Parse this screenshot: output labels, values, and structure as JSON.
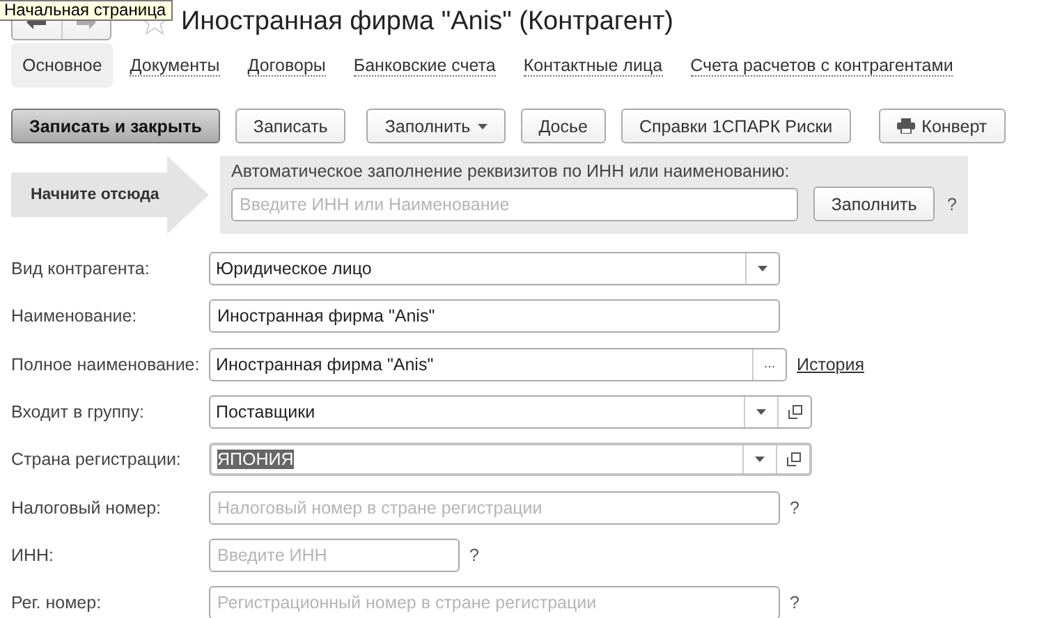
{
  "header": {
    "title": "Иностранная фирма \"Anis\" (Контрагент)",
    "tooltip": "Начальная страница"
  },
  "tabs": [
    {
      "label": "Основное",
      "selected": true
    },
    {
      "label": "Документы",
      "selected": false
    },
    {
      "label": "Договоры",
      "selected": false
    },
    {
      "label": "Банковские счета",
      "selected": false
    },
    {
      "label": "Контактные лица",
      "selected": false
    },
    {
      "label": "Счета расчетов с контрагентами",
      "selected": false
    }
  ],
  "toolbar": [
    {
      "label": "Записать и закрыть",
      "kind": "primary"
    },
    {
      "label": "Записать",
      "kind": "plain"
    },
    {
      "label": "Заполнить",
      "kind": "dropdown"
    },
    {
      "label": "Досье",
      "kind": "plain"
    },
    {
      "label": "Справки 1СПАРК Риски",
      "kind": "plain"
    },
    {
      "label": "Конверт",
      "kind": "print"
    }
  ],
  "quick_fill": {
    "hint": "Начните отсюда",
    "label": "Автоматическое заполнение реквизитов по ИНН или наименованию:",
    "placeholder": "Введите ИНН или Наименование",
    "button": "Заполнить",
    "help": "?"
  },
  "fields": [
    {
      "label": "Вид контрагента:",
      "kind": "select",
      "value": "Юридическое лицо",
      "focused": false
    },
    {
      "label": "Наименование:",
      "kind": "text",
      "value": "Иностранная фирма \"Anis\"",
      "focused": false
    },
    {
      "label": "Полное наименование:",
      "kind": "choice",
      "value": "Иностранная фирма \"Anis\"",
      "button": "...",
      "link": "История",
      "focused": false
    },
    {
      "label": "Входит в группу:",
      "kind": "reference",
      "value": "Поставщики",
      "focused": false
    },
    {
      "label": "Страна регистрации:",
      "kind": "reference",
      "value": "ЯПОНИЯ",
      "focused": true
    },
    {
      "label": "Налоговый номер:",
      "kind": "text",
      "placeholder": "Налоговый номер в стране регистрации",
      "help": "?",
      "focused": false
    },
    {
      "label": "ИНН:",
      "kind": "short",
      "placeholder": "Введите ИНН",
      "help": "?",
      "focused": false
    },
    {
      "label": "Рег. номер:",
      "kind": "text",
      "placeholder": "Регистрационный номер в стране регистрации",
      "help": "?",
      "focused": false
    }
  ]
}
